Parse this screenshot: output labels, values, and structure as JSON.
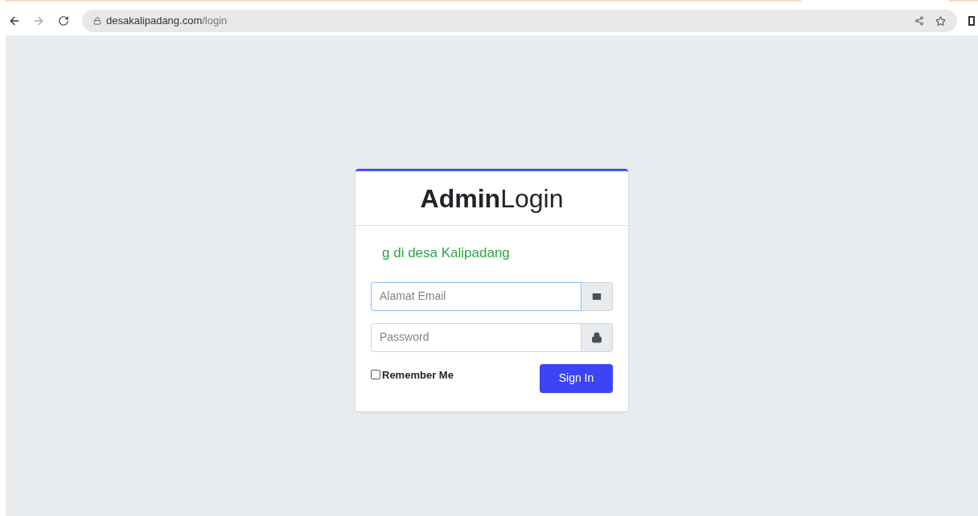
{
  "browser": {
    "url_domain": "desakalipadang.com",
    "url_path": "/login"
  },
  "login": {
    "title_bold": "Admin",
    "title_rest": "Login",
    "marquee": "g di desa Kalipadang",
    "email": {
      "placeholder": "Alamat Email",
      "focused": true
    },
    "password": {
      "placeholder": "Password"
    },
    "remember": {
      "label": "Remember Me",
      "checked": false
    },
    "submit": "Sign In"
  }
}
